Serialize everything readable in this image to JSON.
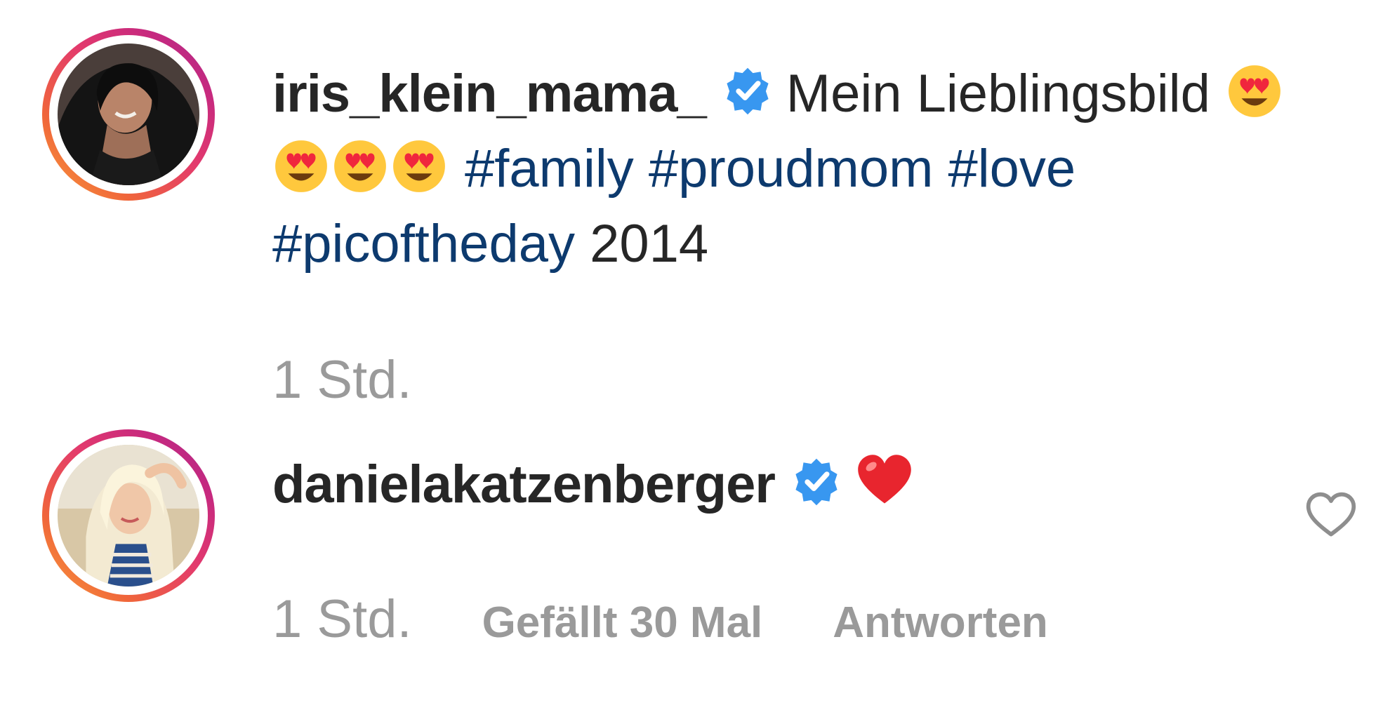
{
  "comments": [
    {
      "username": "iris_klein_mama_",
      "verified": true,
      "caption": "Mein Lieblingsbild",
      "hashtags": [
        "#family",
        "#proudmom",
        "#love",
        "#picoftheday"
      ],
      "caption_suffix": "2014",
      "time": "1 Std.",
      "emoji": [
        "heart-eyes",
        "heart-eyes",
        "heart-eyes",
        "heart-eyes"
      ]
    },
    {
      "username": "danielakatzenberger",
      "verified": true,
      "emoji": [
        "red-heart"
      ],
      "time": "1 Std.",
      "likes_label": "Gefällt 30 Mal",
      "reply_label": "Antworten"
    }
  ],
  "icons": {
    "verified": "verified-badge-icon",
    "like": "heart-outline-icon"
  },
  "colors": {
    "username": "#262626",
    "hashtag": "#0d3a6e",
    "meta": "#9a9a9a",
    "verified": "#3897f0",
    "ring_start": "#f9a13c",
    "ring_end": "#a62a8c"
  }
}
